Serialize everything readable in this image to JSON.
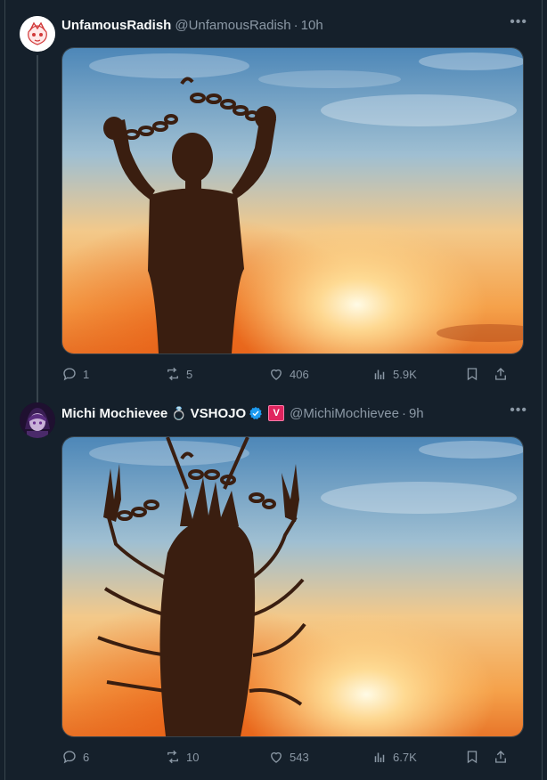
{
  "tweets": [
    {
      "display_name": "UnfamousRadish",
      "handle": "@UnfamousRadish",
      "time": "10h",
      "more": "•••",
      "actions": {
        "replies": "1",
        "retweets": "5",
        "likes": "406",
        "views": "5.9K"
      }
    },
    {
      "display_name": "Michi Mochievee",
      "ring_emoji": "💍",
      "org": "VSHOJO",
      "org_badge": "V",
      "handle": "@MichiMochievee",
      "time": "9h",
      "more": "•••",
      "actions": {
        "replies": "6",
        "retweets": "10",
        "likes": "543",
        "views": "6.7K"
      }
    }
  ],
  "colors": {
    "background": "#15202b",
    "border": "#38444d",
    "muted_text": "#8b98a5",
    "verified_blue": "#1d9bf0",
    "vshojo_pink": "#e0245e"
  },
  "icons": [
    "reply-icon",
    "retweet-icon",
    "like-icon",
    "views-icon",
    "bookmark-icon",
    "share-icon",
    "verified-icon"
  ]
}
